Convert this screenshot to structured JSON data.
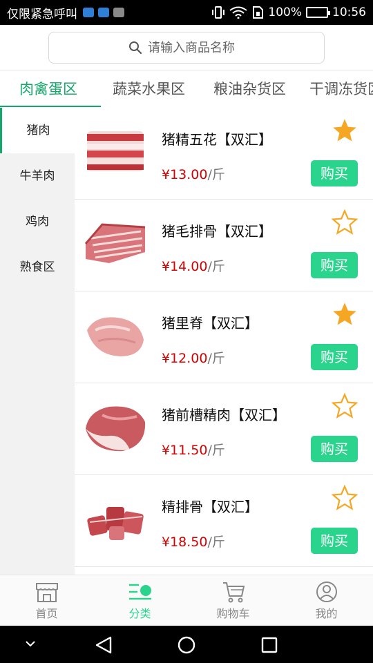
{
  "status_bar": {
    "carrier": "仅限紧急呼叫",
    "battery_percent": "100%",
    "time": "10:56"
  },
  "search": {
    "placeholder": "请输入商品名称"
  },
  "tabs": [
    {
      "label": "肉禽蛋区"
    },
    {
      "label": "蔬菜水果区"
    },
    {
      "label": "粮油杂货区"
    },
    {
      "label": "干调冻货区"
    }
  ],
  "sidebar": {
    "items": [
      {
        "label": "猪肉"
      },
      {
        "label": "牛羊肉"
      },
      {
        "label": "鸡肉"
      },
      {
        "label": "熟食区"
      }
    ]
  },
  "products": [
    {
      "name": "猪精五花【双汇】",
      "price": "¥13.00",
      "unit": "/斤",
      "favorited": true,
      "buy_label": "购买"
    },
    {
      "name": "猪毛排骨【双汇】",
      "price": "¥14.00",
      "unit": "/斤",
      "favorited": false,
      "buy_label": "购买"
    },
    {
      "name": "猪里脊【双汇】",
      "price": "¥12.00",
      "unit": "/斤",
      "favorited": true,
      "buy_label": "购买"
    },
    {
      "name": "猪前槽精肉【双汇】",
      "price": "¥11.50",
      "unit": "/斤",
      "favorited": false,
      "buy_label": "购买"
    },
    {
      "name": "精排骨【双汇】",
      "price": "¥18.50",
      "unit": "/斤",
      "favorited": false,
      "buy_label": "购买"
    }
  ],
  "bottom_nav": [
    {
      "label": "首页",
      "icon": "store-icon"
    },
    {
      "label": "分类",
      "icon": "category-icon"
    },
    {
      "label": "购物车",
      "icon": "cart-icon"
    },
    {
      "label": "我的",
      "icon": "user-icon"
    }
  ],
  "colors": {
    "accent": "#13a86a",
    "buy_button": "#2ad48d",
    "price": "#d40000",
    "star": "#f5a623"
  }
}
